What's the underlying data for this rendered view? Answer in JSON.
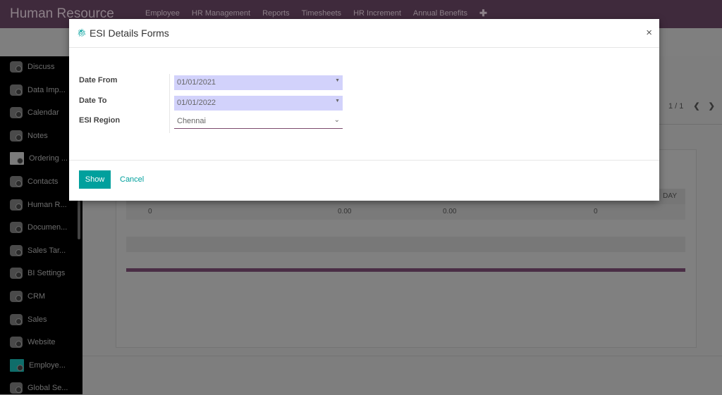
{
  "app": {
    "title": "Human Resource",
    "menu": [
      "Employee",
      "HR Management",
      "Reports",
      "Timesheets",
      "HR Increment",
      "Annual Benefits"
    ],
    "add_icon": "plus-icon"
  },
  "sidebar": {
    "items": [
      {
        "label": "Discuss",
        "icon": "camera-icon"
      },
      {
        "label": "Data Imp...",
        "icon": "camera-icon"
      },
      {
        "label": "Calendar",
        "icon": "camera-icon"
      },
      {
        "label": "Notes",
        "icon": "camera-icon"
      },
      {
        "label": "Ordering ...",
        "icon": "handshake-icon"
      },
      {
        "label": "Contacts",
        "icon": "camera-icon"
      },
      {
        "label": "Human R...",
        "icon": "camera-icon"
      },
      {
        "label": "Documen...",
        "icon": "camera-icon"
      },
      {
        "label": "Sales Tar...",
        "icon": "camera-icon"
      },
      {
        "label": "BI Settings",
        "icon": "camera-icon"
      },
      {
        "label": "CRM",
        "icon": "camera-icon"
      },
      {
        "label": "Sales",
        "icon": "camera-icon"
      },
      {
        "label": "Website",
        "icon": "camera-icon"
      },
      {
        "label": "Employe...",
        "icon": "map-pin-icon"
      },
      {
        "label": "Global Se...",
        "icon": "camera-icon"
      }
    ]
  },
  "pager": {
    "text": "1 / 1"
  },
  "report": {
    "header_tail": "DAY",
    "row": [
      "0",
      "0.00",
      "0.00",
      "0"
    ]
  },
  "modal": {
    "title": "ESI Details Forms",
    "fields": [
      {
        "label": "Date From",
        "value": "01/01/2021"
      },
      {
        "label": "Date To",
        "value": "01/01/2022"
      },
      {
        "label": "ESI Region",
        "value": "Chennai"
      }
    ],
    "show": "Show",
    "cancel": "Cancel"
  },
  "colors": {
    "accent": "#00a09d",
    "brand": "#3f2a3c",
    "date_bg": "#d2d2fb"
  }
}
